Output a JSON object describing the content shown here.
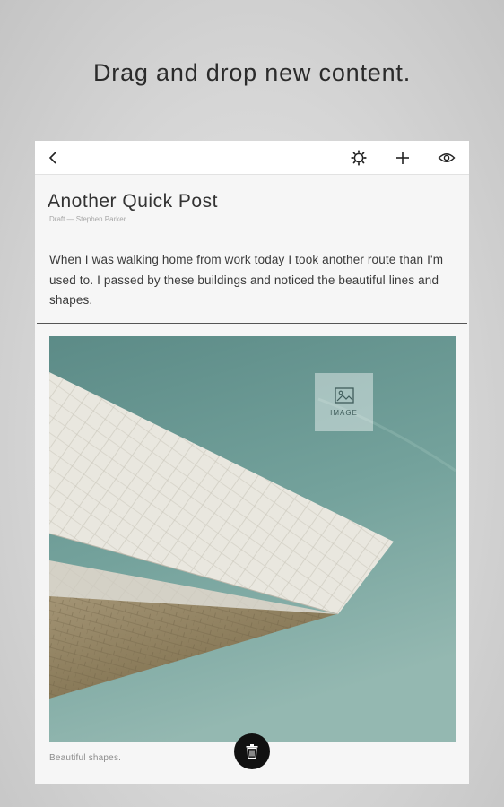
{
  "headline": "Drag and drop new content.",
  "toolbar": {
    "back_icon": "chevron-left-icon",
    "settings_icon": "gear-icon",
    "add_icon": "plus-icon",
    "preview_icon": "eye-icon"
  },
  "post": {
    "title": "Another Quick Post",
    "meta": "Draft — Stephen Parker",
    "body": "When I was walking home from work today I took another route than I'm used to. I passed by these buildings and noticed the beautiful lines and shapes.",
    "image_chip_label": "IMAGE",
    "caption": "Beautiful shapes."
  },
  "colors": {
    "sky_top": "#5e8d89",
    "sky_bottom": "#8eb3ad",
    "facade_light": "#e9e7df",
    "facade_shadow": "#8b7c5a",
    "trash_button": "#111111"
  }
}
